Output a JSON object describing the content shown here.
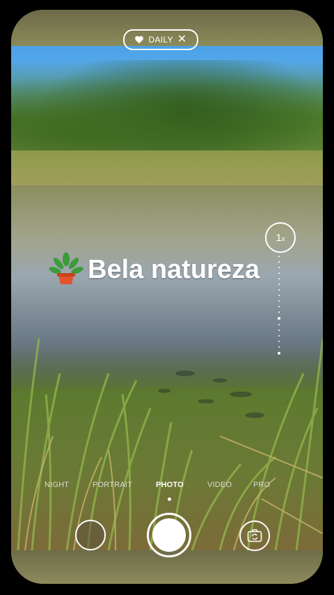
{
  "badge": {
    "label": "DAILY",
    "icon": "heart-icon",
    "close_icon": "close-icon"
  },
  "zoom": {
    "value": "1",
    "unit": "x"
  },
  "caption": {
    "text": "Bela natureza",
    "sticker_icon": "potted-plant-icon"
  },
  "modes": [
    {
      "label": "NIGHT",
      "active": false
    },
    {
      "label": "PORTRAIT",
      "active": false
    },
    {
      "label": "PHOTO",
      "active": true
    },
    {
      "label": "VIDEO",
      "active": false
    },
    {
      "label": "PRO",
      "active": false
    }
  ],
  "controls": {
    "gallery_icon": "gallery-thumbnail-icon",
    "shutter_icon": "shutter-icon",
    "flip_icon": "camera-flip-icon"
  }
}
